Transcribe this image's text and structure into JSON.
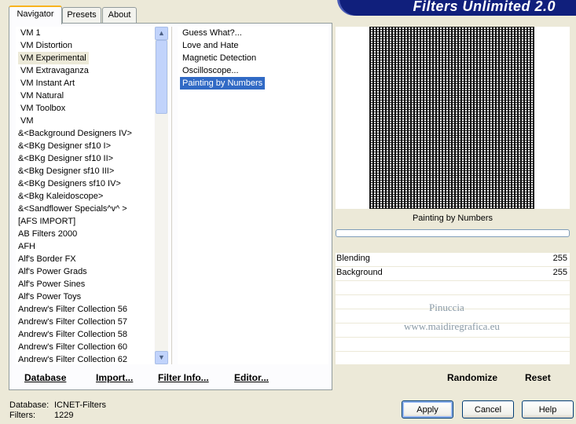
{
  "title": "Filters Unlimited 2.0",
  "tabs": [
    {
      "label": "Navigator",
      "active": true
    },
    {
      "label": "Presets",
      "active": false
    },
    {
      "label": "About",
      "active": false
    }
  ],
  "categories": [
    "VM 1",
    "VM Distortion",
    "VM Experimental",
    "VM Extravaganza",
    "VM Instant Art",
    "VM Natural",
    "VM Toolbox",
    "VM",
    "&<Background Designers IV>",
    "&<BKg Designer sf10 I>",
    "&<BKg Designer sf10 II>",
    "&<Bkg Designer sf10 III>",
    "&<BKg Designers sf10 IV>",
    "&<Bkg Kaleidoscope>",
    "&<Sandflower Specials^v^ >",
    "[AFS IMPORT]",
    "AB Filters 2000",
    "AFH",
    "Alf's Border FX",
    "Alf's Power Grads",
    "Alf's Power Sines",
    "Alf's Power Toys",
    "Andrew's Filter Collection 56",
    "Andrew's Filter Collection 57",
    "Andrew's Filter Collection 58",
    "Andrew's Filter Collection 60",
    "Andrew's Filter Collection 62"
  ],
  "selected_category": "VM Experimental",
  "filters": [
    "Guess  What?...",
    "Love and Hate",
    "Magnetic Detection",
    "Oscilloscope...",
    "Painting by Numbers"
  ],
  "selected_filter": "Painting by Numbers",
  "preview_filter_name": "Painting by Numbers",
  "parameters": [
    {
      "label": "Blending",
      "value": "255"
    },
    {
      "label": "Background",
      "value": "255"
    }
  ],
  "watermark": {
    "line1": "Pinuccia",
    "line2": "www.maidiregrafica.eu"
  },
  "toolbar": {
    "database": "Database",
    "import": "Import...",
    "filter_info": "Filter Info...",
    "editor": "Editor...",
    "randomize": "Randomize",
    "reset": "Reset"
  },
  "status": {
    "database_label": "Database:",
    "database_value": "ICNET-Filters",
    "filters_label": "Filters:",
    "filters_value": "1229"
  },
  "buttons": {
    "apply": "Apply",
    "cancel": "Cancel",
    "help": "Help"
  }
}
